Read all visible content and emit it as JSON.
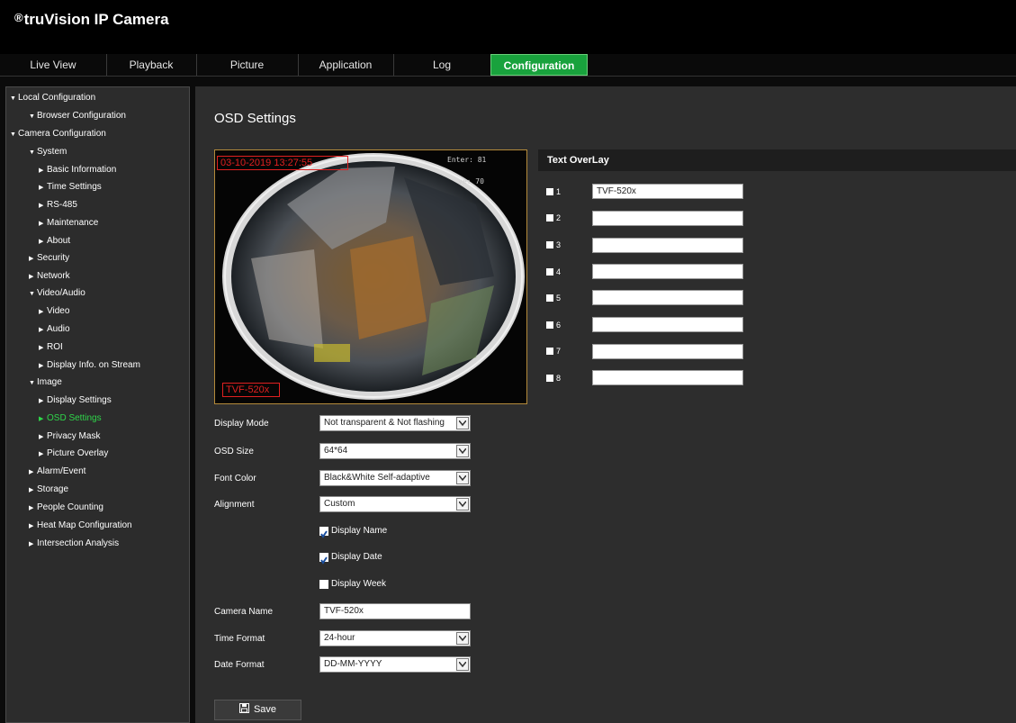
{
  "app": {
    "logo_mark": "®",
    "logo_text": "truVision  IP Camera"
  },
  "tabs": [
    {
      "label": "Live View"
    },
    {
      "label": "Playback"
    },
    {
      "label": "Picture"
    },
    {
      "label": "Application"
    },
    {
      "label": "Log"
    },
    {
      "label": "Configuration"
    }
  ],
  "sidebar": {
    "items": [
      {
        "label": "Local Configuration",
        "caret": "▼"
      },
      {
        "label": "Browser Configuration",
        "caret": "▼"
      },
      {
        "label": "Camera Configuration",
        "caret": "▼"
      },
      {
        "label": "System",
        "caret": "▼"
      },
      {
        "label": "Basic Information",
        "caret": "▶"
      },
      {
        "label": "Time Settings",
        "caret": "▶"
      },
      {
        "label": "RS-485",
        "caret": "▶"
      },
      {
        "label": "Maintenance",
        "caret": "▶"
      },
      {
        "label": "About",
        "caret": "▶"
      },
      {
        "label": "Security",
        "caret": "▶"
      },
      {
        "label": "Network",
        "caret": "▶"
      },
      {
        "label": "Video/Audio",
        "caret": "▼"
      },
      {
        "label": "Video",
        "caret": "▶"
      },
      {
        "label": "Audio",
        "caret": "▶"
      },
      {
        "label": "ROI",
        "caret": "▶"
      },
      {
        "label": "Display Info. on Stream",
        "caret": "▶"
      },
      {
        "label": "Image",
        "caret": "▼"
      },
      {
        "label": "Display Settings",
        "caret": "▶"
      },
      {
        "label": "OSD Settings",
        "caret": "▶"
      },
      {
        "label": "Privacy Mask",
        "caret": "▶"
      },
      {
        "label": "Picture Overlay",
        "caret": "▶"
      },
      {
        "label": "Alarm/Event",
        "caret": "▶"
      },
      {
        "label": "Storage",
        "caret": "▶"
      },
      {
        "label": "People Counting",
        "caret": "▶"
      },
      {
        "label": "Heat Map Configuration",
        "caret": "▶"
      },
      {
        "label": "Intersection Analysis",
        "caret": "▶"
      }
    ]
  },
  "main": {
    "title": "OSD Settings",
    "preview": {
      "osd_datetime": "03-10-2019 13:27:55",
      "enter_text": "Enter: 81",
      "leave_text": "ve: 70",
      "camera_name_overlay": "TVF-520x"
    },
    "text_overlay": {
      "header": "Text OverLay",
      "rows": [
        {
          "num": "1",
          "value": "TVF-520x"
        },
        {
          "num": "2",
          "value": ""
        },
        {
          "num": "3",
          "value": ""
        },
        {
          "num": "4",
          "value": ""
        },
        {
          "num": "5",
          "value": ""
        },
        {
          "num": "6",
          "value": ""
        },
        {
          "num": "7",
          "value": ""
        },
        {
          "num": "8",
          "value": ""
        }
      ]
    },
    "form": {
      "display_mode": {
        "label": "Display Mode",
        "value": "Not transparent & Not flashing"
      },
      "osd_size": {
        "label": "OSD Size",
        "value": "64*64"
      },
      "font_color": {
        "label": "Font Color",
        "value": "Black&White Self-adaptive"
      },
      "alignment": {
        "label": "Alignment",
        "value": "Custom"
      },
      "display_name": {
        "label": "Display Name",
        "checked": true
      },
      "display_date": {
        "label": "Display Date",
        "checked": true
      },
      "display_week": {
        "label": "Display Week",
        "checked": false
      },
      "camera_name": {
        "label": "Camera Name",
        "value": "TVF-520x"
      },
      "time_format": {
        "label": "Time Format",
        "value": "24-hour"
      },
      "date_format": {
        "label": "Date Format",
        "value": "DD-MM-YYYY"
      }
    },
    "save_label": "Save"
  },
  "colors": {
    "accent_green": "#19a23d",
    "active_nav": "#2fd64a",
    "preview_border": "#b48a3a",
    "osd_red": "#e02020"
  }
}
